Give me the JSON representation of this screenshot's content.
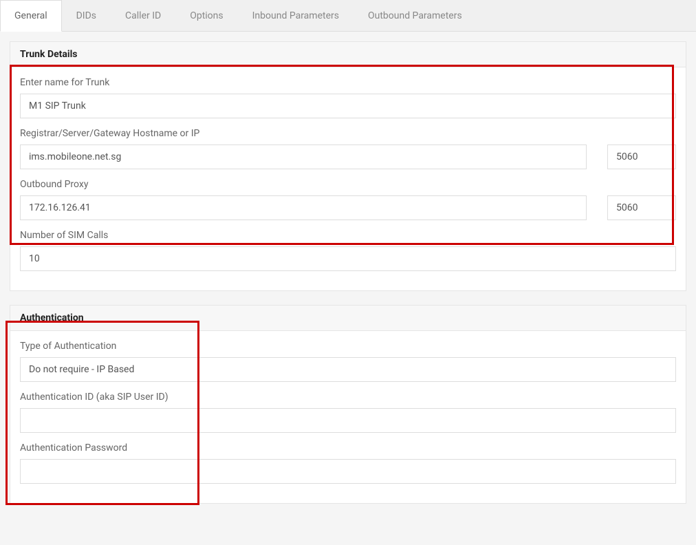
{
  "tabs": [
    {
      "label": "General",
      "active": true
    },
    {
      "label": "DIDs",
      "active": false
    },
    {
      "label": "Caller ID",
      "active": false
    },
    {
      "label": "Options",
      "active": false
    },
    {
      "label": "Inbound Parameters",
      "active": false
    },
    {
      "label": "Outbound Parameters",
      "active": false
    }
  ],
  "trunk_details": {
    "header": "Trunk Details",
    "name_label": "Enter name for Trunk",
    "name_value": "M1 SIP Trunk",
    "registrar_label": "Registrar/Server/Gateway Hostname or IP",
    "registrar_value": "ims.mobileone.net.sg",
    "registrar_port": "5060",
    "outbound_proxy_label": "Outbound Proxy",
    "outbound_proxy_value": "172.16.126.41",
    "outbound_proxy_port": "5060",
    "sim_calls_label": "Number of SIM Calls",
    "sim_calls_value": "10"
  },
  "authentication": {
    "header": "Authentication",
    "type_label": "Type of Authentication",
    "type_value": "Do not require - IP Based",
    "auth_id_label": "Authentication ID (aka SIP User ID)",
    "auth_id_value": "",
    "auth_password_label": "Authentication Password",
    "auth_password_value": ""
  }
}
